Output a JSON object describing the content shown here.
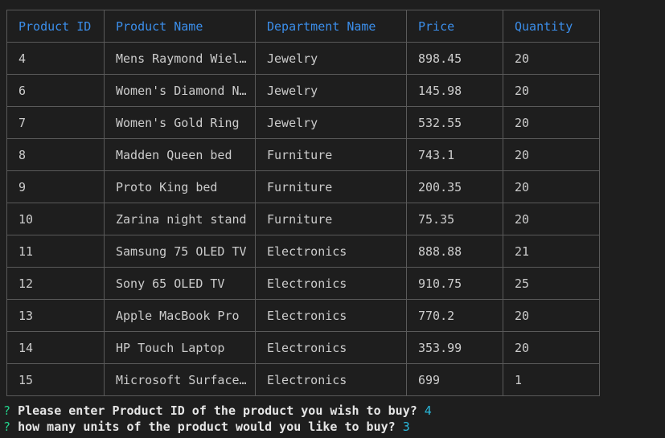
{
  "table": {
    "headers": [
      "Product ID",
      "Product Name",
      "Department Name",
      "Price",
      "Quantity"
    ],
    "rows": [
      [
        "4",
        "Mens Raymond Wiel…",
        "Jewelry",
        "898.45",
        "20"
      ],
      [
        "6",
        "Women's Diamond N…",
        "Jewelry",
        "145.98",
        "20"
      ],
      [
        "7",
        "Women's Gold Ring",
        "Jewelry",
        "532.55",
        "20"
      ],
      [
        "8",
        "Madden Queen bed",
        "Furniture",
        "743.1",
        "20"
      ],
      [
        "9",
        "Proto King bed",
        "Furniture",
        "200.35",
        "20"
      ],
      [
        "10",
        "Zarina night stand",
        "Furniture",
        "75.35",
        "20"
      ],
      [
        "11",
        "Samsung 75 OLED TV",
        "Electronics",
        "888.88",
        "21"
      ],
      [
        "12",
        "Sony 65 OLED TV",
        "Electronics",
        "910.75",
        "25"
      ],
      [
        "13",
        "Apple MacBook Pro",
        "Electronics",
        "770.2",
        "20"
      ],
      [
        "14",
        "HP Touch Laptop",
        "Electronics",
        "353.99",
        "20"
      ],
      [
        "15",
        "Microsoft Surface…",
        "Electronics",
        "699",
        "1"
      ]
    ]
  },
  "prompts": [
    {
      "mark": "?",
      "question": "Please enter Product ID of the product you wish to buy?",
      "answer": "4"
    },
    {
      "mark": "?",
      "question": "how many units of the product would you like to buy?",
      "answer": "3"
    }
  ],
  "colors": {
    "background": "#1e1e1e",
    "header_text": "#3b8eea",
    "prompt_mark": "#23d18b",
    "answer_text": "#29b8db"
  }
}
